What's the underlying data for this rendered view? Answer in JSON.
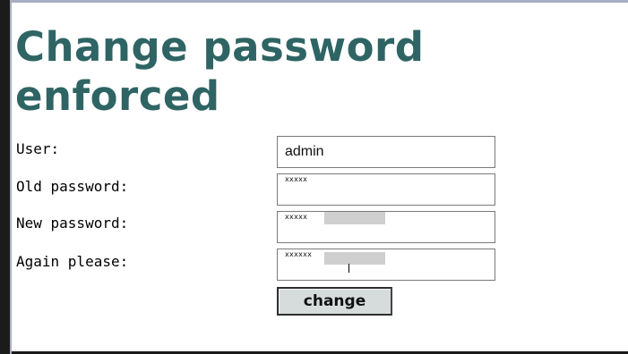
{
  "form": {
    "title_line1": "Change password",
    "title_line2": "enforced",
    "user_label": "User:",
    "user_value": "admin",
    "old_password_label": "Old password:",
    "old_password_mask": "xxxxx",
    "new_password_label": "New password:",
    "new_password_mask": "xxxxx",
    "again_label": "Again please:",
    "again_mask": "xxxxxx",
    "submit_label": "change"
  },
  "colors": {
    "title": "#2f6464",
    "button_bg": "#d6dcdc",
    "frame_border": "#a9aec4"
  }
}
